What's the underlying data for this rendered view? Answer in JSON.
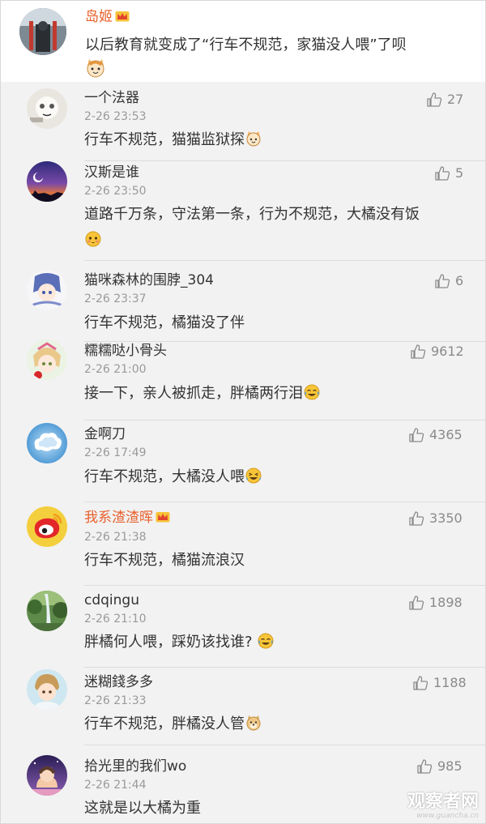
{
  "post": {
    "author": "岛姬",
    "content": "以后教育就变成了“行车不规范，家猫没人喂”了呗"
  },
  "replies": [
    {
      "name": "一个法器",
      "time": "2-26 23:53",
      "text": "行车不规范，猫猫监狱探",
      "likes": "27",
      "emoji": "cat-face-emoji",
      "vip": false
    },
    {
      "name": "汉斯是谁",
      "time": "2-26 23:50",
      "text": "道路千万条，守法第一条，行为不规范，大橘没有饭",
      "likes": "5",
      "emoji": "flushed-emoji",
      "vip": false
    },
    {
      "name": "猫咪森林的围脖_304",
      "time": "2-26 23:37",
      "text": "行车不规范，橘猫没了伴",
      "likes": "6",
      "emoji": "",
      "vip": false
    },
    {
      "name": "糯糯哒小骨头",
      "time": "2-26 21:00",
      "text": "接一下，亲人被抓走，胖橘两行泪",
      "likes": "9612",
      "emoji": "tears-of-joy-emoji",
      "vip": false
    },
    {
      "name": "金啊刀",
      "time": "2-26 17:49",
      "text": "行车不规范，大橘没人喂",
      "likes": "4365",
      "emoji": "laughing-emoji",
      "vip": false
    },
    {
      "name": "我系渣渣晖",
      "time": "2-26 21:38",
      "text": "行车不规范，橘猫流浪汉",
      "likes": "3350",
      "emoji": "",
      "vip": true
    },
    {
      "name": "cdqingu",
      "time": "2-26 21:10",
      "text": "胖橘何人喂，踩奶该找谁?",
      "likes": "1898",
      "emoji": "tears-of-joy-emoji",
      "vip": false
    },
    {
      "name": "迷糊錢多多",
      "time": "2-26 21:33",
      "text": "行车不规范，胖橘没人管",
      "likes": "1188",
      "emoji": "doge-emoji",
      "vip": false
    },
    {
      "name": "拾光里的我们wo",
      "time": "2-26 21:44",
      "text": "这就是以大橘为重",
      "likes": "985",
      "emoji": "",
      "vip": false
    }
  ],
  "watermark": {
    "main": "观察者网",
    "sub": "www.guancha.cn"
  },
  "colors": {
    "vip_name": "#e8602c",
    "reply_bg": "#f2f2f2",
    "like_gray": "#8a8a8a"
  }
}
